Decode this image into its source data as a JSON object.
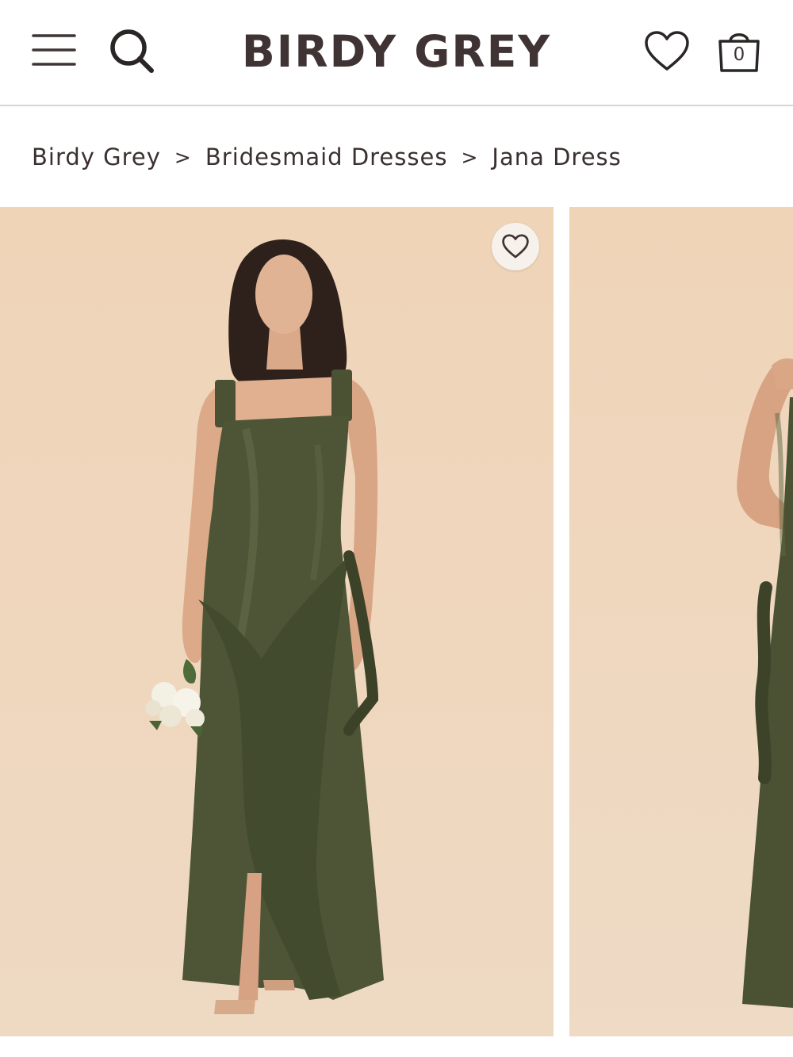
{
  "header": {
    "logo": "BIRDY GREY",
    "cart_count": "0",
    "icons": [
      "hamburger-menu-icon",
      "search-icon",
      "heart-icon",
      "shopping-bag-icon"
    ]
  },
  "breadcrumb": {
    "items": [
      "Birdy Grey",
      "Bridesmaid Dresses",
      "Jana Dress"
    ],
    "separator": ">"
  },
  "gallery": {
    "favorite_icon": "heart-outline-icon"
  },
  "colors": {
    "brand_text": "#3f3333",
    "backdrop": "#efd6bb",
    "dress": "#4d5536"
  }
}
